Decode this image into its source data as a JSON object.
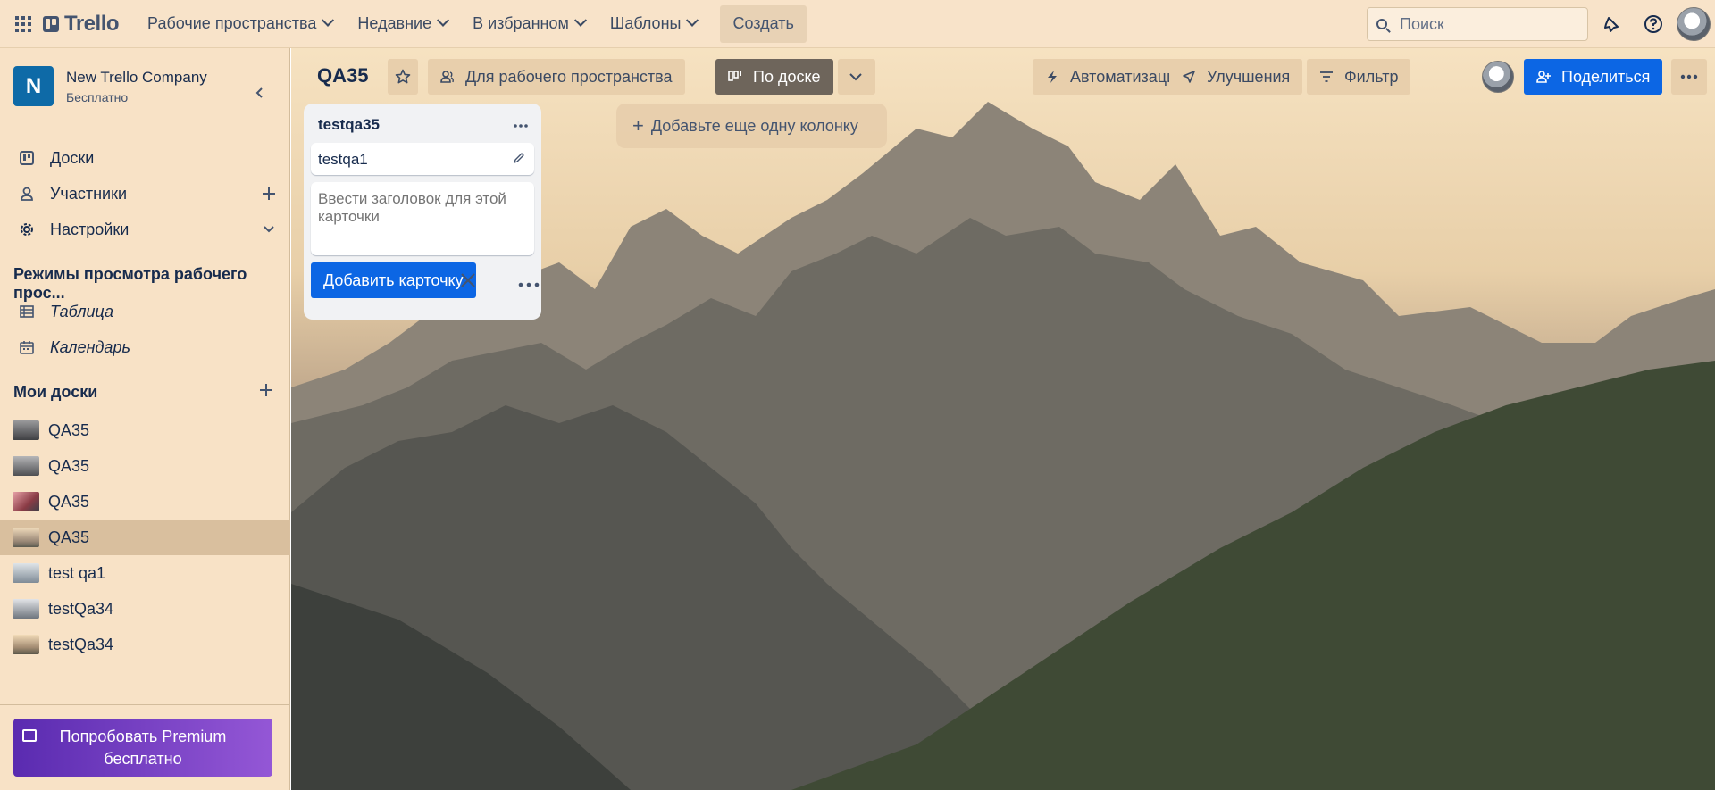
{
  "topnav": {
    "brand": "Trello",
    "menus": [
      "Рабочие пространства",
      "Недавние",
      "В избранном",
      "Шаблоны"
    ],
    "create_label": "Создать",
    "search_placeholder": "Поиск",
    "icons": [
      "apps-grid-icon",
      "notifications-icon",
      "help-icon",
      "user-avatar"
    ]
  },
  "sidebar": {
    "workspace": {
      "initial": "N",
      "name": "New Trello Company",
      "plan": "Бесплатно"
    },
    "nav": [
      {
        "label": "Доски",
        "icon": "board-icon"
      },
      {
        "label": "Участники",
        "icon": "person-icon"
      },
      {
        "label": "Настройки",
        "icon": "gear-icon"
      }
    ],
    "views_title": "Режимы просмотра рабочего прос...",
    "views": [
      {
        "label": "Таблица",
        "icon": "table-icon"
      },
      {
        "label": "Календарь",
        "icon": "calendar-icon"
      }
    ],
    "my_boards_title": "Мои доски",
    "boards": [
      {
        "label": "QA35",
        "thumb": "#5f6064"
      },
      {
        "label": "QA35",
        "thumb": "#6c6d70"
      },
      {
        "label": "QA35",
        "thumb": "#8a3b45"
      },
      {
        "label": "QA35",
        "thumb": "#b99a7a"
      },
      {
        "label": "test qa1",
        "thumb": "#8f9aa4"
      },
      {
        "label": "testQa34",
        "thumb": "#8b929a"
      },
      {
        "label": "testQa34",
        "thumb": "#c7a980"
      }
    ],
    "premium": {
      "line1": "Попробовать Premium",
      "line2": "бесплатно"
    }
  },
  "board": {
    "title": "QA35",
    "visibility_label": "Для рабочего пространства",
    "view_label": "По доске",
    "automation_label": "Автоматизация",
    "powerups_label": "Улучшения",
    "filter_label": "Фильтр",
    "share_label": "Поделиться",
    "lists": [
      {
        "title": "testqa35",
        "cards": [
          "testqa1"
        ],
        "composer_placeholder": "Ввести заголовок для этой карточки",
        "add_card_label": "Добавить карточку"
      }
    ],
    "add_column_label": "Добавьте еще одну колонку"
  },
  "colors": {
    "accent": "#0c66e4",
    "nav_bg": "#f8e3c9",
    "premium_from": "#5a2bb0",
    "premium_to": "#9457d6"
  }
}
